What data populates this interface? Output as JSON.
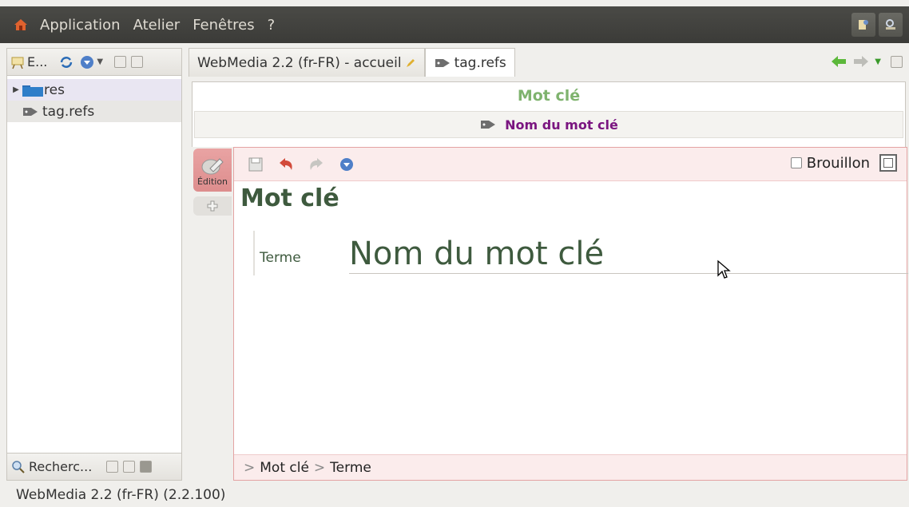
{
  "menubar": {
    "items": [
      "Application",
      "Atelier",
      "Fenêtres",
      "?"
    ]
  },
  "explorer": {
    "title": "E...",
    "tree": [
      {
        "label": "res",
        "type": "folder"
      },
      {
        "label": "tag.refs",
        "type": "tag"
      }
    ],
    "bottom_title": "Recherc..."
  },
  "tabs": [
    {
      "label": "WebMedia 2.2 (fr-FR) - accueil"
    },
    {
      "label": "tag.refs"
    }
  ],
  "doc": {
    "title": "Mot clé",
    "subtitle": "Nom du mot clé"
  },
  "editor": {
    "side_tab_label": "Édition",
    "draft_label": "Brouillon",
    "form_title": "Mot clé",
    "field_label": "Terme",
    "field_value": "Nom du mot clé",
    "breadcrumb": [
      "Mot clé",
      "Terme"
    ]
  },
  "status": {
    "text": "WebMedia 2.2 (fr-FR) (2.2.100)"
  },
  "colors": {
    "doc_title": "#7fb36e",
    "doc_subtitle": "#7a1580",
    "form_text": "#3e5a3e",
    "edit_accent": "#e4a3a3"
  }
}
